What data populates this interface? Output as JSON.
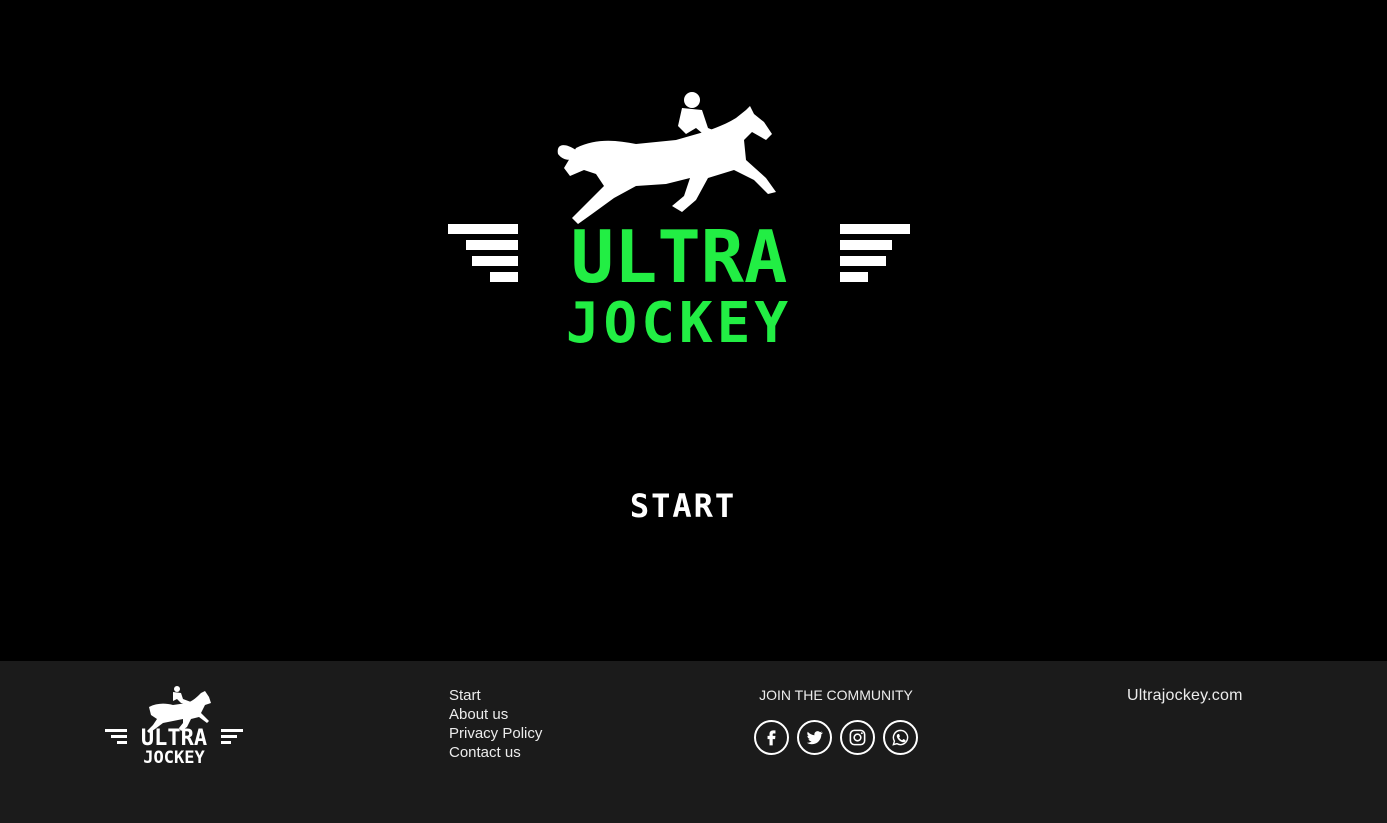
{
  "brand": {
    "logo_line1": "ULTRA",
    "logo_line2": "JOCKEY",
    "logo_color": "#22ee44",
    "horse_icon": "horse-rider-icon"
  },
  "hero": {
    "start_label": "START"
  },
  "footer": {
    "links": [
      "Start",
      "About us",
      "Privacy Policy",
      "Contact us"
    ],
    "community_title": "JOIN THE COMMUNITY",
    "social": [
      "facebook-icon",
      "twitter-icon",
      "instagram-icon",
      "whatsapp-icon"
    ],
    "site": "Ultrajockey.com",
    "background": "#1b1b1b"
  }
}
